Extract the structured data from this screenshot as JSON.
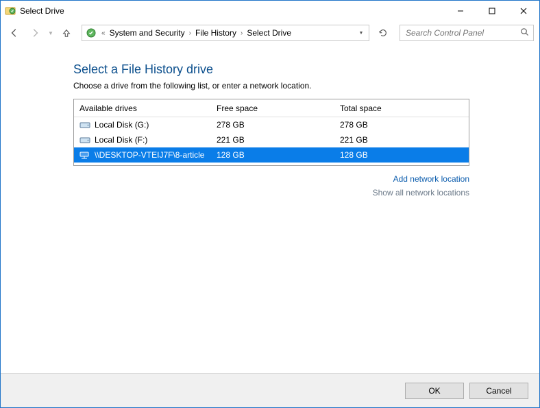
{
  "window": {
    "title": "Select Drive"
  },
  "nav": {
    "breadcrumb_prefix": "«",
    "segments": [
      "System and Security",
      "File History",
      "Select Drive"
    ],
    "search_placeholder": "Search Control Panel"
  },
  "page": {
    "heading": "Select a File History drive",
    "subtext": "Choose a drive from the following list, or enter a network location."
  },
  "table": {
    "columns": [
      "Available drives",
      "Free space",
      "Total space"
    ],
    "rows": [
      {
        "name": "Local Disk (G:)",
        "free": "278 GB",
        "total": "278 GB",
        "type": "local",
        "selected": false
      },
      {
        "name": "Local Disk (F:)",
        "free": "221 GB",
        "total": "221 GB",
        "type": "local",
        "selected": false
      },
      {
        "name": "\\\\DESKTOP-VTEIJ7F\\8-article",
        "free": "128 GB",
        "total": "128 GB",
        "type": "network",
        "selected": true
      }
    ]
  },
  "links": {
    "add_network": "Add network location",
    "show_all": "Show all network locations"
  },
  "footer": {
    "ok": "OK",
    "cancel": "Cancel"
  }
}
